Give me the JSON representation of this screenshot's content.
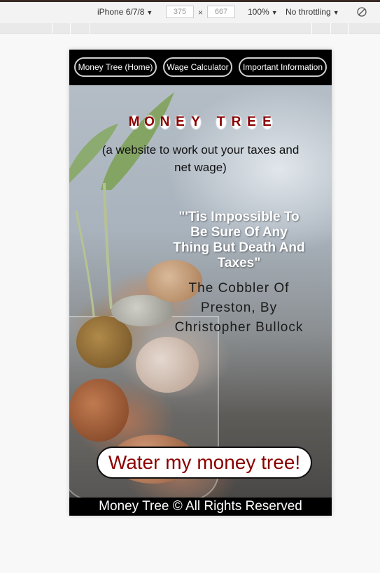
{
  "devtools": {
    "device": "iPhone 6/7/8",
    "width": "375",
    "height": "667",
    "zoom": "100%",
    "throttling": "No throttling"
  },
  "nav": {
    "home": "Money Tree (Home)",
    "wage": "Wage Calculator",
    "info": "Important Information"
  },
  "hero": {
    "title": "MONEY TREE",
    "subtitle": "(a website to work out your taxes and net wage)",
    "quote": "\"'Tis Impossible To Be Sure Of Any Thing But Death And Taxes\"",
    "attribution": "The Cobbler Of Preston, By Christopher Bullock",
    "cta": "Water my money tree!"
  },
  "footer": {
    "text": "Money Tree © All Rights Reserved"
  },
  "colors": {
    "accent": "#8b0000",
    "nav_bg": "#000000"
  }
}
